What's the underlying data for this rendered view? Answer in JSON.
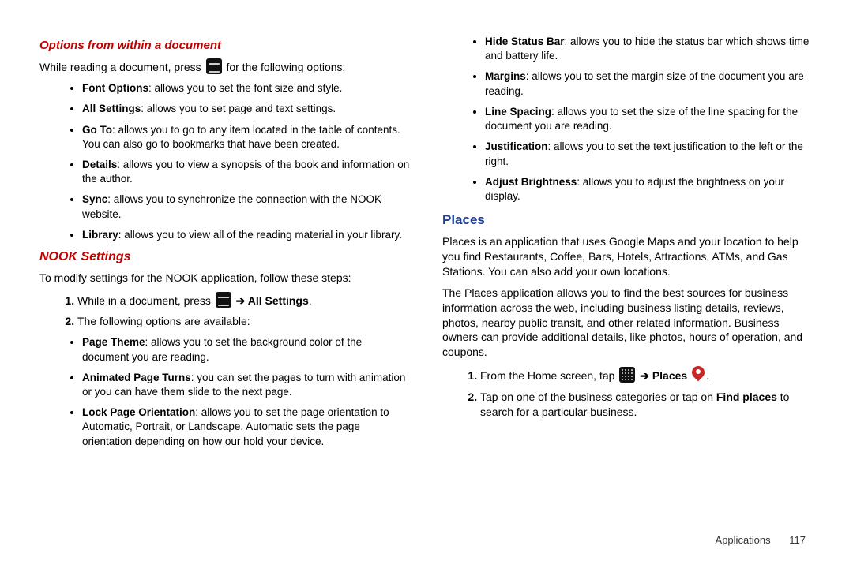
{
  "left": {
    "h_options": "Options from within a document",
    "intro_a": "While reading a document, press ",
    "intro_b": " for the following options:",
    "bullets": [
      {
        "b": "Font Options",
        "t": ": allows you to set the font size and style."
      },
      {
        "b": "All Settings",
        "t": ": allows you to set page and text settings."
      },
      {
        "b": "Go To",
        "t": ": allows you to go to any item located in the table of contents. You can also go to bookmarks that have been created."
      },
      {
        "b": "Details",
        "t": ": allows you to view a synopsis of the book and information on the author."
      },
      {
        "b": "Sync",
        "t": ": allows you to synchronize the connection with the NOOK website."
      },
      {
        "b": "Library",
        "t": ": allows you to view all of the reading material in your library."
      }
    ],
    "h_nook": "NOOK Settings",
    "nook_intro": "To modify settings for the NOOK application, follow these steps:",
    "step1_a": "While in a document, press ",
    "step1_b": "All Settings",
    "step2": "The following options are available:",
    "settings": [
      {
        "b": "Page Theme",
        "t": ": allows you to set the background color of the document you are reading."
      },
      {
        "b": "Animated Page Turns",
        "t": ": you can set the pages to turn with animation or you can have them slide to the next page."
      },
      {
        "b": "Lock Page Orientation",
        "t": ": allows you to set the page orientation to Automatic, Portrait, or Landscape. Automatic sets the page orientation depending on how our hold your device."
      }
    ]
  },
  "right": {
    "bullets_cont": [
      {
        "b": "Hide Status Bar",
        "t": ": allows you to hide the status bar which shows time and battery life."
      },
      {
        "b": "Margins",
        "t": ": allows you to set the margin size of the document you are reading."
      },
      {
        "b": "Line Spacing",
        "t": ": allows you to set the size of the line spacing for the document you are reading."
      },
      {
        "b": "Justification",
        "t": ": allows you to set the text justification to the left or the right."
      },
      {
        "b": "Adjust Brightness",
        "t": ": allows you to adjust the brightness on your display."
      }
    ],
    "h_places": "Places",
    "p1": "Places is an application that uses Google Maps and your location to help you find Restaurants, Coffee, Bars, Hotels, Attractions, ATMs, and Gas Stations. You can also add your own locations.",
    "p2": "The Places application allows you to find the best sources for business information across the web, including business listing details, reviews, photos, nearby public transit, and other related information. Business owners can provide additional details, like photos, hours of operation, and coupons.",
    "step1_a": "From the Home screen, tap ",
    "step1_b": "Places",
    "step2_a": "Tap on one of the business categories or tap on ",
    "step2_b": "Find places",
    "step2_c": " to search for a particular business."
  },
  "footer": {
    "section": "Applications",
    "page": "117"
  }
}
